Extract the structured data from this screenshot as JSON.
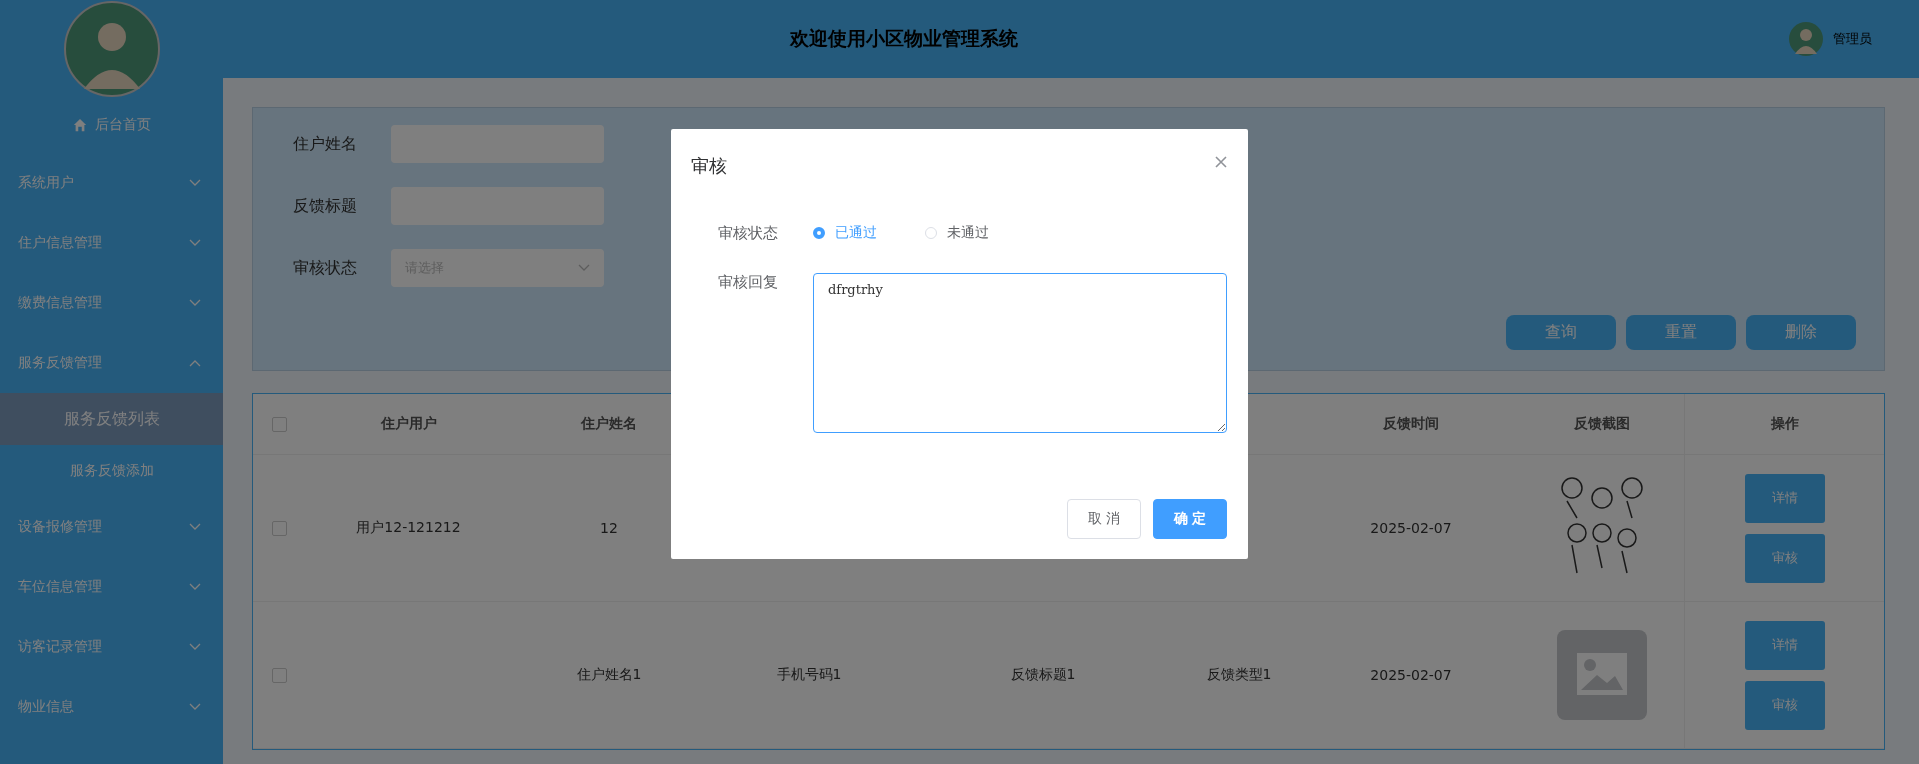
{
  "sidebar": {
    "home": {
      "label": "后台首页"
    },
    "items": [
      {
        "label": "系统用户",
        "expanded": false
      },
      {
        "label": "住户信息管理",
        "expanded": false
      },
      {
        "label": "缴费信息管理",
        "expanded": false
      },
      {
        "label": "服务反馈管理",
        "expanded": true,
        "children": [
          {
            "label": "服务反馈列表",
            "selected": true
          },
          {
            "label": "服务反馈添加",
            "selected": false
          }
        ]
      },
      {
        "label": "设备报修管理",
        "expanded": false
      },
      {
        "label": "车位信息管理",
        "expanded": false
      },
      {
        "label": "访客记录管理",
        "expanded": false
      },
      {
        "label": "物业信息",
        "expanded": false
      }
    ]
  },
  "header": {
    "title": "欢迎使用小区物业管理系统",
    "user": "管理员"
  },
  "search": {
    "fields": [
      {
        "label": "住户姓名",
        "kind": "input"
      },
      {
        "label": "反馈标题",
        "kind": "input"
      },
      {
        "label": "审核状态",
        "kind": "select",
        "placeholder": "请选择"
      }
    ],
    "buttons": [
      "查询",
      "重置",
      "删除"
    ]
  },
  "table": {
    "all_checked": false,
    "columns": [
      {
        "label": "住户用户"
      },
      {
        "label": "住户姓名"
      },
      {},
      {},
      {},
      {
        "label": "反馈时间"
      },
      {
        "label": "反馈截图"
      },
      {
        "label": "操作"
      }
    ],
    "rows": [
      {
        "checked": false,
        "cells": [
          "用户12-121212",
          "12",
          null,
          null,
          null,
          "2025-02-07"
        ],
        "screenshot": {
          "kind": "drawing"
        },
        "actions": [
          "详情",
          "审核"
        ]
      },
      {
        "checked": false,
        "cells": [
          null,
          "住户姓名1",
          "手机号码1",
          "反馈标题1",
          "反馈类型1",
          "2025-02-07"
        ],
        "screenshot": {
          "kind": "placeholder"
        },
        "actions": [
          "详情",
          "审核"
        ]
      }
    ]
  },
  "dialog": {
    "title": "审核",
    "status_label": "审核状态",
    "options": [
      {
        "label": "已通过",
        "selected": true
      },
      {
        "label": "未通过",
        "selected": false
      }
    ],
    "reply_label": "审核回复",
    "reply": "dfrgtrhy",
    "buttons": [
      {
        "label": "取 消",
        "kind": "secondary"
      },
      {
        "label": "确 定",
        "kind": "primary"
      }
    ]
  }
}
